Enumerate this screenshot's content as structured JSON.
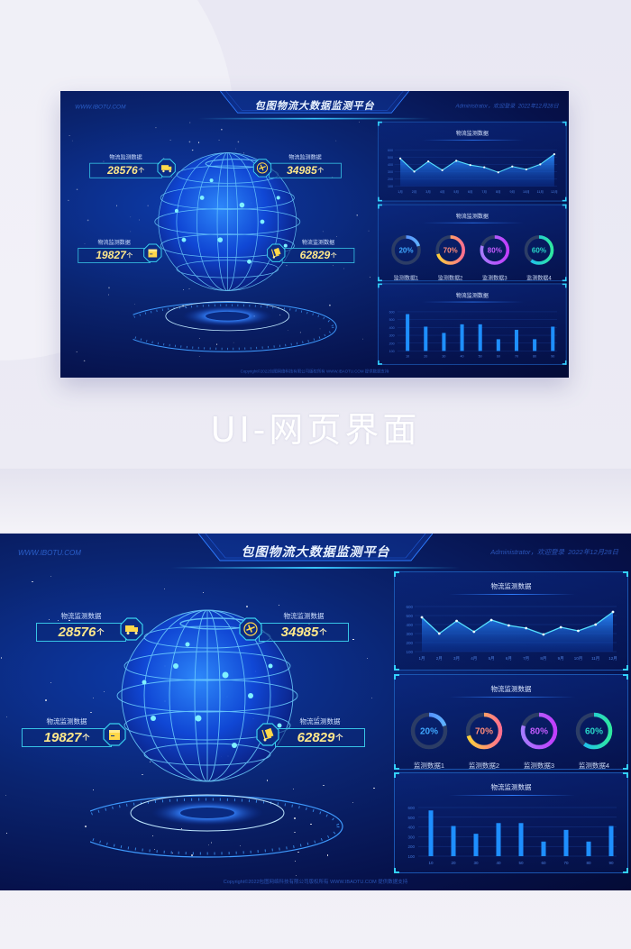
{
  "caption": "UI-网页界面",
  "header": {
    "site": "WWW.IBOTU.COM",
    "title": "包图物流大数据监测平台",
    "user_greeting": "Administrator，欢迎登录",
    "date": "2022年12月28日"
  },
  "stats": [
    {
      "label": "物流监测数据",
      "value": "28576",
      "unit": "个",
      "icon": "delivery-truck-icon"
    },
    {
      "label": "物流监测数据",
      "value": "34985",
      "unit": "个",
      "icon": "airplane-icon"
    },
    {
      "label": "物流监测数据",
      "value": "19827",
      "unit": "个",
      "icon": "package-box-icon"
    },
    {
      "label": "物流监测数据",
      "value": "62829",
      "unit": "个",
      "icon": "hand-cart-icon"
    }
  ],
  "panels": {
    "line_title": "物流监测数据",
    "donut_title": "物流监测数据",
    "bar_title": "物流监测数据"
  },
  "donuts": [
    {
      "label": "监测数据1",
      "percent": 20,
      "text": "20%",
      "color_a": "#4a6dff",
      "color_b": "#5fb3ff",
      "text_color": "#3fa8ff"
    },
    {
      "label": "监测数据2",
      "percent": 70,
      "text": "70%",
      "color_a": "#ffd23a",
      "color_b": "#ff6f8f",
      "text_color": "#ff8a7a"
    },
    {
      "label": "监测数据3",
      "percent": 80,
      "text": "80%",
      "color_a": "#a67bff",
      "color_b": "#c13dff",
      "text_color": "#c45cff"
    },
    {
      "label": "监测数据4",
      "percent": 60,
      "text": "60%",
      "color_a": "#1bb7ff",
      "color_b": "#2ee8a0",
      "text_color": "#28d6c8"
    }
  ],
  "copyright": "Copyright©2022包图网络科技有限公司版权所有 WWW.IBAOTU.COM 提供数据支持",
  "chart_data": [
    {
      "type": "area",
      "title": "物流监测数据",
      "categories": [
        "1月",
        "2月",
        "3月",
        "4月",
        "5月",
        "6月",
        "7月",
        "8月",
        "9月",
        "10月",
        "11月",
        "12月"
      ],
      "values": [
        480,
        300,
        440,
        320,
        450,
        390,
        360,
        290,
        370,
        330,
        400,
        540
      ],
      "yticks": [
        "100",
        "200",
        "300",
        "400",
        "500",
        "600"
      ],
      "ylim": [
        100,
        600
      ],
      "grid": true
    },
    {
      "type": "bar",
      "title": "物流监测数据",
      "categories": [
        "10",
        "20",
        "30",
        "40",
        "50",
        "60",
        "70",
        "80",
        "90"
      ],
      "values": [
        570,
        410,
        330,
        440,
        440,
        250,
        370,
        250,
        410
      ],
      "yticks": [
        "100",
        "200",
        "300",
        "400",
        "500",
        "600"
      ],
      "ylim": [
        100,
        600
      ],
      "grid": true
    }
  ]
}
